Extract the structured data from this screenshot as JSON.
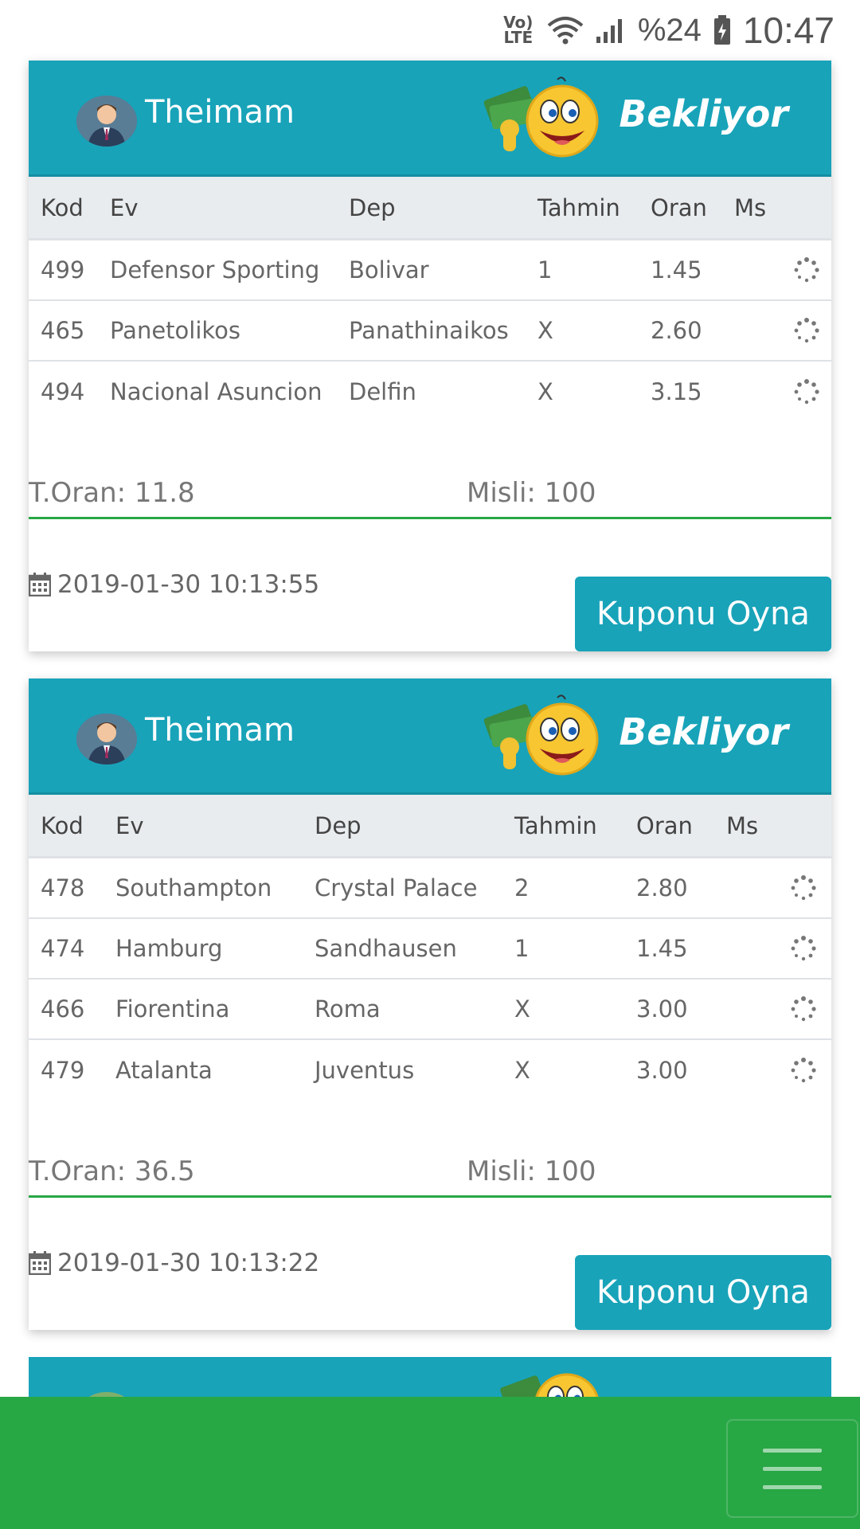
{
  "status_bar": {
    "network": "VoLTE",
    "battery": "%24",
    "time": "10:47"
  },
  "table_headers": {
    "kod": "Kod",
    "ev": "Ev",
    "dep": "Dep",
    "tahmin": "Tahmin",
    "oran": "Oran",
    "ms": "Ms"
  },
  "coupons": [
    {
      "user": "Theimam",
      "status": "Bekliyor",
      "rows": [
        {
          "kod": "499",
          "ev": "Defensor Sporting",
          "dep": "Bolivar",
          "tahmin": "1",
          "oran": "1.45"
        },
        {
          "kod": "465",
          "ev": "Panetolikos",
          "dep": "Panathinaikos",
          "tahmin": "X",
          "oran": "2.60"
        },
        {
          "kod": "494",
          "ev": "Nacional Asuncion",
          "dep": "Delfin",
          "tahmin": "X",
          "oran": "3.15"
        }
      ],
      "total_odds": "T.Oran: 11.8",
      "misli": "Misli: 100",
      "date": "2019-01-30 10:13:55",
      "button": "Kuponu Oyna"
    },
    {
      "user": "Theimam",
      "status": "Bekliyor",
      "rows": [
        {
          "kod": "478",
          "ev": "Southampton",
          "dep": "Crystal Palace",
          "tahmin": "2",
          "oran": "2.80"
        },
        {
          "kod": "474",
          "ev": "Hamburg",
          "dep": "Sandhausen",
          "tahmin": "1",
          "oran": "1.45"
        },
        {
          "kod": "466",
          "ev": "Fiorentina",
          "dep": "Roma",
          "tahmin": "X",
          "oran": "3.00"
        },
        {
          "kod": "479",
          "ev": "Atalanta",
          "dep": "Juventus",
          "tahmin": "X",
          "oran": "3.00"
        }
      ],
      "total_odds": "T.Oran: 36.5",
      "misli": "Misli: 100",
      "date": "2019-01-30 10:13:22",
      "button": "Kuponu Oyna"
    }
  ],
  "icons": {
    "calendar": "calendar-icon",
    "spinner": "loading-spinner-icon",
    "menu": "hamburger-menu-icon"
  },
  "colors": {
    "header": "#18a3b9",
    "accent_green": "#28a745",
    "table_head": "#e9ecef"
  }
}
